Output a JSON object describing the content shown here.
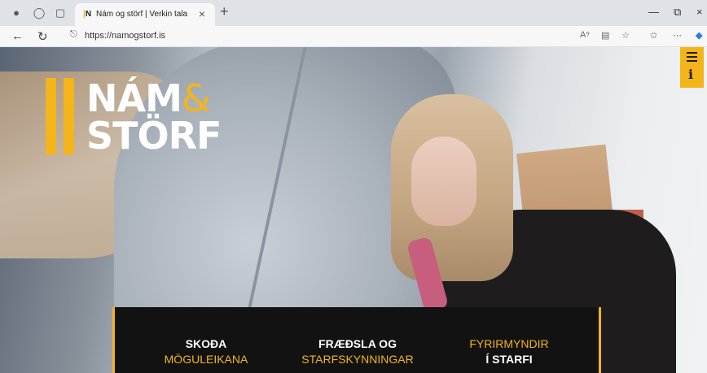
{
  "browser": {
    "tab_title": "Nám og störf | Verkin tala",
    "tab_favicon": "N",
    "url": "https://namogstorf.is"
  },
  "logo": {
    "line1": "NÁM",
    "ampersand": "&",
    "line2": "STÖRF"
  },
  "nav": [
    {
      "line1": "SKOÐA",
      "line2": "MÖGULEIKANA"
    },
    {
      "line1": "FRÆÐSLA OG",
      "line2": "STARFSKYNNINGAR"
    },
    {
      "line1": "FYRIRMYNDIR",
      "line2": "Í STARFI"
    }
  ],
  "colors": {
    "accent": "#f4b51a",
    "panel": "#121212"
  }
}
